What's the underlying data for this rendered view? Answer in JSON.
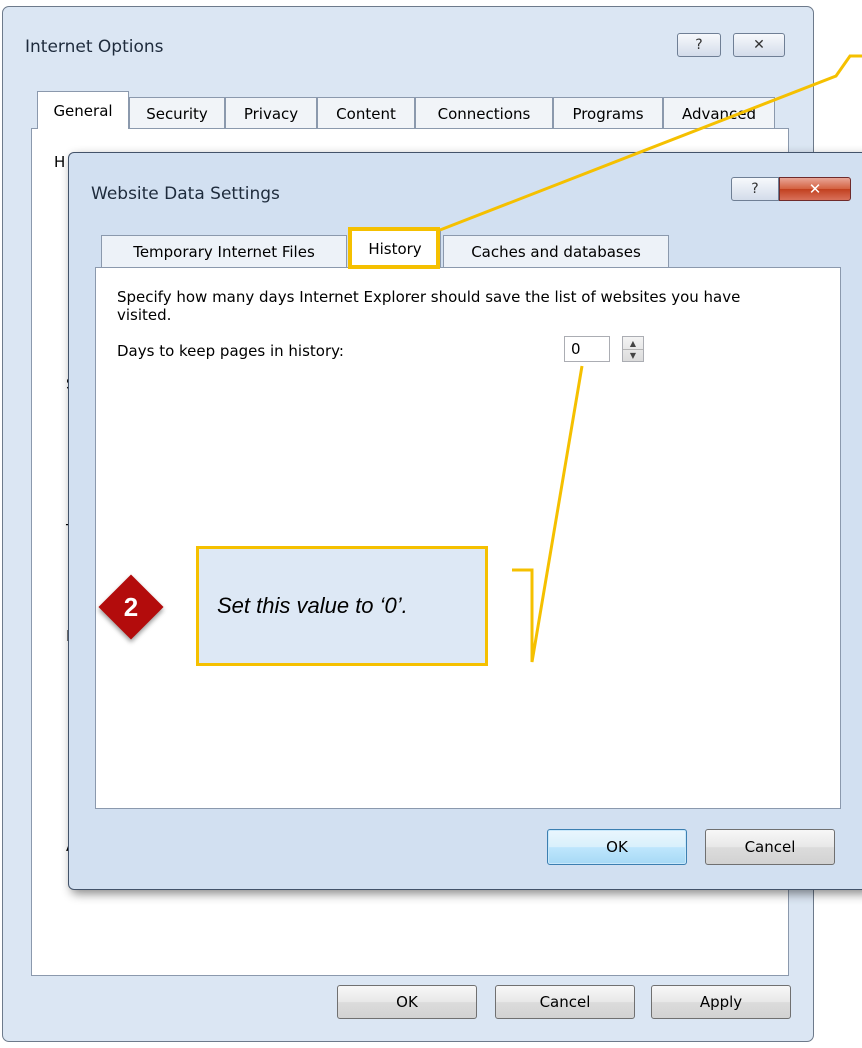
{
  "internet_options": {
    "title": "Internet Options",
    "help_glyph": "?",
    "close_glyph": "✕",
    "tabs": [
      {
        "label": "General",
        "active": true
      },
      {
        "label": "Security"
      },
      {
        "label": "Privacy"
      },
      {
        "label": "Content"
      },
      {
        "label": "Connections"
      },
      {
        "label": "Programs"
      },
      {
        "label": "Advanced"
      }
    ],
    "partial_letters": [
      "H",
      "S",
      "T",
      "B",
      "A"
    ],
    "ok_label": "OK",
    "cancel_label": "Cancel",
    "apply_label": "Apply"
  },
  "website_data_settings": {
    "title": "Website Data Settings",
    "help_glyph": "?",
    "close_glyph": "✕",
    "tabs": [
      {
        "label": "Temporary Internet Files"
      },
      {
        "label": "History",
        "active": true
      },
      {
        "label": "Caches and databases"
      }
    ],
    "history": {
      "description": "Specify how many days Internet Explorer should save the list of websites you have visited.",
      "days_label": "Days to keep pages in history:",
      "days_value": "0"
    },
    "ok_label": "OK",
    "cancel_label": "Cancel"
  },
  "annotation": {
    "step_number": "2",
    "callout_text": "Set this value to ‘0’.",
    "highlight_color": "#f5c000",
    "badge_color": "#b30c0c"
  }
}
